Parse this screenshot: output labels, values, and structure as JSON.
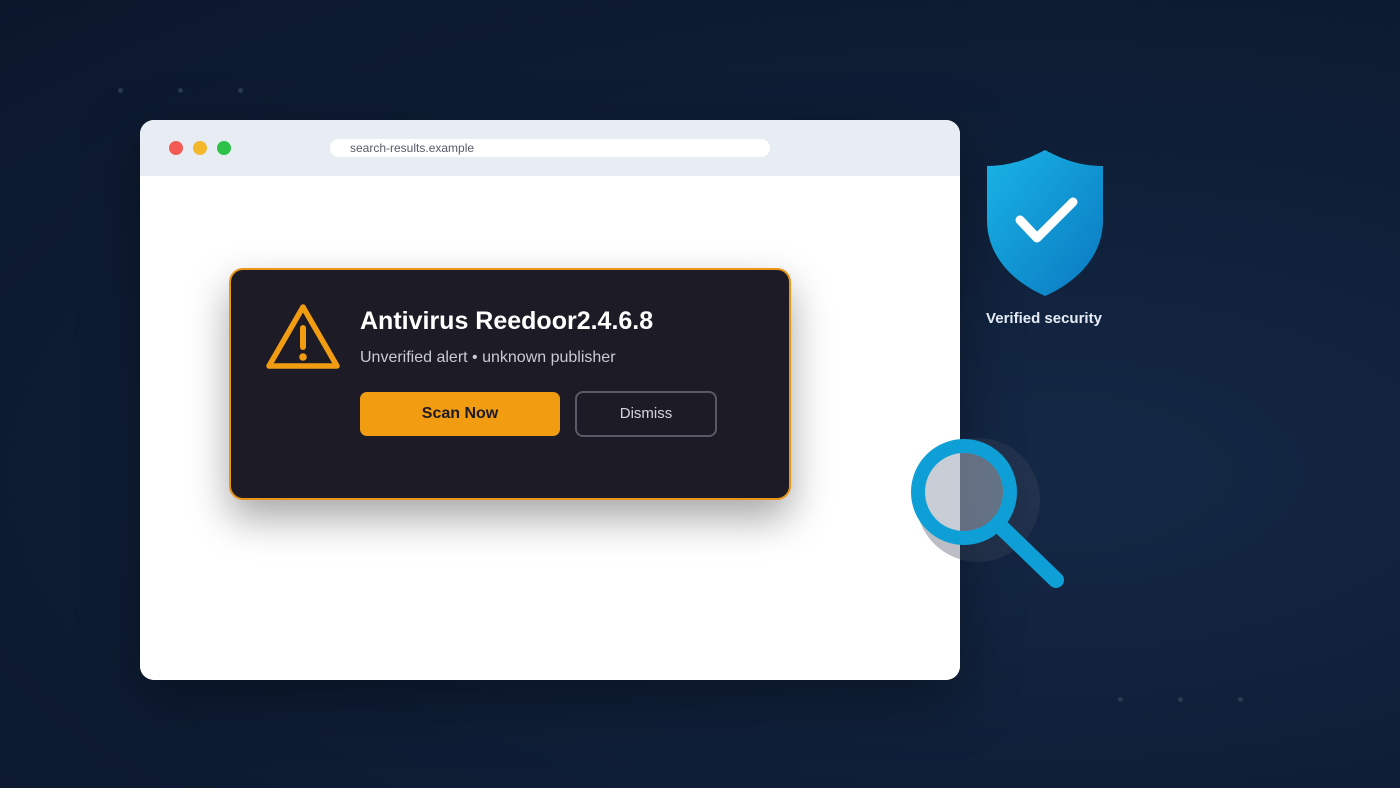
{
  "browser": {
    "url": "search-results.example",
    "traffic_lights": [
      "#f45b54",
      "#f4b72b",
      "#2dc24a"
    ]
  },
  "popup": {
    "title": "Antivirus Reedoor2.4.6.8",
    "subtitle": "Unverified alert • unknown publisher",
    "scan_label": "Scan Now",
    "dismiss_label": "Dismiss",
    "accent_color": "#f29c12"
  },
  "shield": {
    "label": "Verified security",
    "color": "#0a8fd0"
  },
  "icons": {
    "warning": "warning-triangle-icon",
    "shield": "shield-check-icon",
    "magnifier": "magnifier-icon"
  }
}
